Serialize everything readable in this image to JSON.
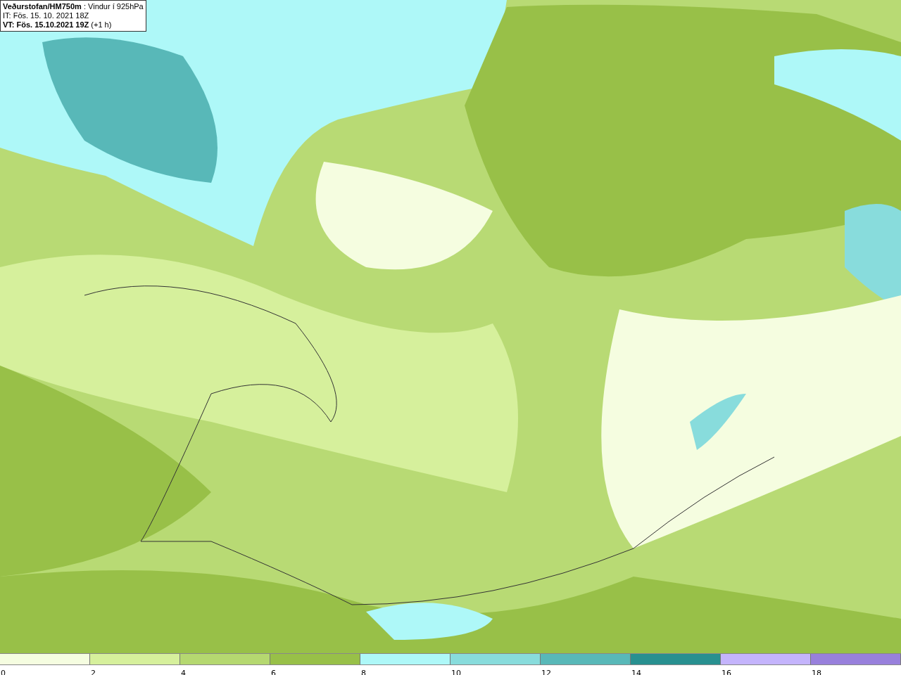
{
  "header": {
    "lines": [
      "**Veðurstofan/HM750m** : Vindur í 925hPa",
      "IT: Fös. 15. 10. 2021 18Z",
      "**VT: Fös. 15.10.2021 19Z** (+1 h)"
    ]
  },
  "legend": {
    "segments": [
      {
        "color": "#f5fde0"
      },
      {
        "color": "#d6f09c"
      },
      {
        "color": "#b5d870"
      },
      {
        "color": "#98c048"
      },
      {
        "color": "#aef8f8"
      },
      {
        "color": "#88dcdc"
      },
      {
        "color": "#58b8b8"
      },
      {
        "color": "#289090"
      },
      {
        "color": "#c4b4fc"
      },
      {
        "color": "#9880dc"
      }
    ],
    "ticks": [
      "0",
      "2",
      "4",
      "6",
      "8",
      "10",
      "12",
      "14",
      "16",
      "18"
    ]
  }
}
